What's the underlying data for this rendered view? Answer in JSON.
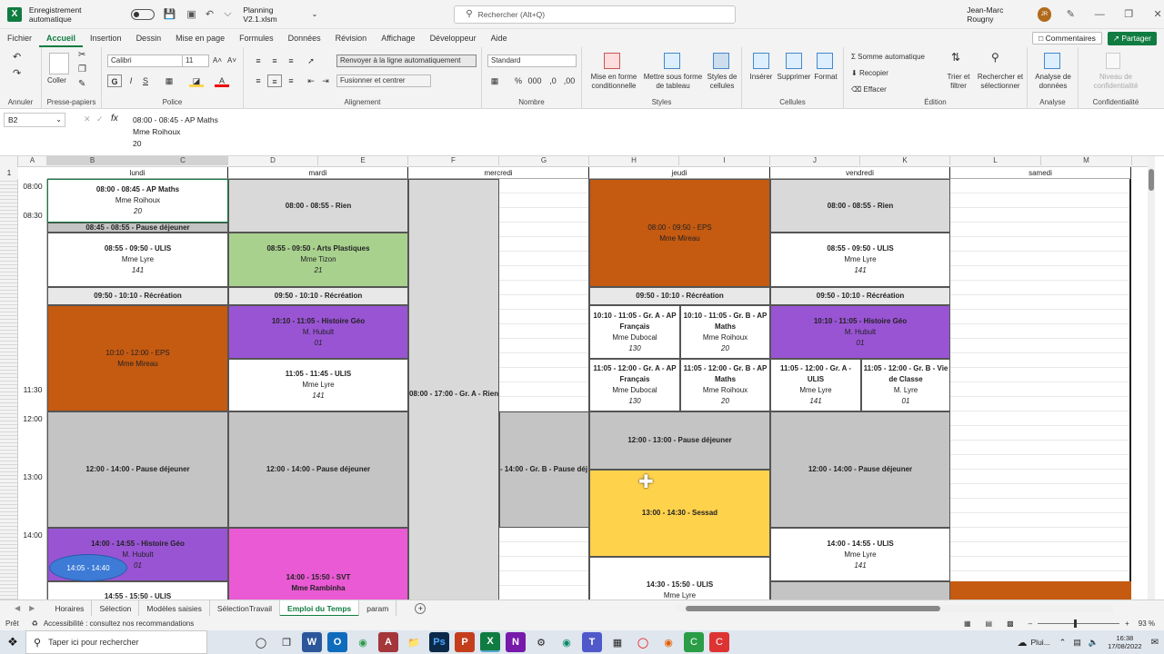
{
  "titlebar": {
    "autosave_label": "Enregistrement automatique",
    "filename": "Planning V2.1.xlsm",
    "search_placeholder": "Rechercher (Alt+Q)",
    "user_name": "Jean-Marc Rougny",
    "user_initials": "JR"
  },
  "menu": {
    "tabs": [
      "Fichier",
      "Accueil",
      "Insertion",
      "Dessin",
      "Mise en page",
      "Formules",
      "Données",
      "Révision",
      "Affichage",
      "Développeur",
      "Aide"
    ],
    "comments": "Commentaires",
    "share": "Partager"
  },
  "ribbon": {
    "undo_label": "Annuler",
    "clipboard_label": "Presse-papiers",
    "paste": "Coller",
    "font_name": "Calibri",
    "font_size": "11",
    "font_label": "Police",
    "wrap_text": "Renvoyer à la ligne automatiquement",
    "merge_center": "Fusionner et centrer",
    "alignment_label": "Alignement",
    "number_format": "Standard",
    "number_label": "Nombre",
    "cond_format": "Mise en forme conditionnelle",
    "format_table": "Mettre sous forme de tableau",
    "cell_styles": "Styles de cellules",
    "styles_label": "Styles",
    "insert": "Insérer",
    "delete": "Supprimer",
    "format": "Format",
    "cells_label": "Cellules",
    "autosum": "Somme automatique",
    "fill": "Recopier",
    "clear": "Effacer",
    "sort_filter": "Trier et filtrer",
    "find_select": "Rechercher et sélectionner",
    "editing_label": "Édition",
    "analyze": "Analyse de données",
    "analysis_label": "Analyse",
    "sensitivity": "Niveau de confidentialité",
    "confidentiality_label": "Confidentialité"
  },
  "formula": {
    "cell_ref": "B2",
    "fx": "fx",
    "line1": "08:00 - 08:45 - AP Maths",
    "line2": "Mme Roihoux",
    "line3": "20"
  },
  "grid": {
    "col_letters": [
      "A",
      "B",
      "C",
      "D",
      "E",
      "F",
      "G",
      "H",
      "I",
      "J",
      "K",
      "L",
      "M"
    ],
    "days": [
      "lundi",
      "mardi",
      "mercredi",
      "jeudi",
      "vendredi",
      "samedi"
    ],
    "row1": "1",
    "times": [
      "08:00",
      "08:30",
      "11:30",
      "12:00",
      "13:00",
      "14:00"
    ],
    "lundi": [
      {
        "t": "08:00 - 08:45 - AP Maths",
        "p": "Mme Roihoux",
        "r": "20"
      },
      {
        "t": "08:45 - 08:55 - Pause déjeuner"
      },
      {
        "t": "08:55 - 09:50 - ULIS",
        "p": "Mme Lyre",
        "r": "141"
      },
      {
        "t": "09:50 - 10:10 - Récréation"
      },
      {
        "t": "10:10 - 12:00 - EPS",
        "p": "Mme Mireau"
      },
      {
        "t": "12:00 - 14:00 - Pause déjeuner"
      },
      {
        "t": "14:00 - 14:55 - Histoire Géo",
        "p": "M. Hubult",
        "r": "01"
      },
      {
        "t": "14:55 - 15:50 - ULIS"
      }
    ],
    "mardi": [
      {
        "t": "08:00 - 08:55 - Rien"
      },
      {
        "t": "08:55 - 09:50 - Arts Plastiques",
        "p": "Mme Tizon",
        "r": "21"
      },
      {
        "t": "09:50 - 10:10 - Récréation"
      },
      {
        "t": "10:10 - 11:05 - Histoire Géo",
        "p": "M. Hubult",
        "r": "01"
      },
      {
        "t": "11:05 - 11:45 - ULIS",
        "p": "Mme Lyre",
        "r": "141"
      },
      {
        "t": "12:00 - 14:00 - Pause déjeuner"
      },
      {
        "t": "14:00 - 15:50 - SVT",
        "p": "Mme Rambinha"
      }
    ],
    "mercredi": [
      {
        "t": "08:00 - 17:00 - Gr. A - Rien"
      },
      {
        "t": "- 14:00 - Gr. B - Pause déj"
      }
    ],
    "jeudi": [
      {
        "t": "08:00 - 09:50 - EPS",
        "p": "Mme Mireau"
      },
      {
        "t": "09:50 - 10:10 - Récréation"
      },
      {
        "t": "10:10 - 11:05 - Gr. A - AP Français",
        "p": "Mme Dubocal",
        "r": "130"
      },
      {
        "t": "10:10 - 11:05 - Gr. B - AP Maths",
        "p": "Mme Roihoux",
        "r": "20"
      },
      {
        "t": "11:05 - 12:00 - Gr. A - AP Français",
        "p": "Mme Dubocal",
        "r": "130"
      },
      {
        "t": "11:05 - 12:00 - Gr. B - AP Maths",
        "p": "Mme Roihoux",
        "r": "20"
      },
      {
        "t": "12:00 - 13:00 - Pause déjeuner"
      },
      {
        "t": "13:00 - 14:30 - Sessad"
      },
      {
        "t": "14:30 - 15:50 - ULIS",
        "p": "Mme Lyre"
      }
    ],
    "vendredi": [
      {
        "t": "08:00 - 08:55 - Rien"
      },
      {
        "t": "08:55 - 09:50 - ULIS",
        "p": "Mme Lyre",
        "r": "141"
      },
      {
        "t": "09:50 - 10:10 - Récréation"
      },
      {
        "t": "10:10 - 11:05 - Histoire Géo",
        "p": "M. Hubult",
        "r": "01"
      },
      {
        "t": "11:05 - 12:00 - Gr. A - ULIS",
        "p": "Mme Lyre",
        "r": "141"
      },
      {
        "t": "11:05 - 12:00 - Gr. B - Vie de Classe",
        "p": "M. Lyre",
        "r": "01"
      },
      {
        "t": "12:00 - 14:00 - Pause déjeuner"
      },
      {
        "t": "14:00 - 14:55 - ULIS",
        "p": "Mme Lyre",
        "r": "141"
      }
    ],
    "tooltip": "14:05 - 14:40"
  },
  "sheets": [
    "Horaires",
    "Sélection",
    "Modèles saisies",
    "SélectionTravail",
    "Emploi du Temps",
    "param"
  ],
  "status": {
    "ready": "Prêt",
    "accessibility": "Accessibilité : consultez nos recommandations",
    "zoom": "93 %"
  },
  "taskbar": {
    "search": "Taper ici pour rechercher",
    "weather": "Plui...",
    "time": "16:38",
    "date": "17/08/2022"
  },
  "colors": {
    "green": "#107c41",
    "orange": "#c55a11",
    "purple": "#9954d4",
    "lightgreen": "#a9d18e",
    "yellow": "#ffd24c",
    "pink": "#ea5ad4",
    "gray": "#c4c4c4",
    "lightgray": "#e8e8e8"
  }
}
